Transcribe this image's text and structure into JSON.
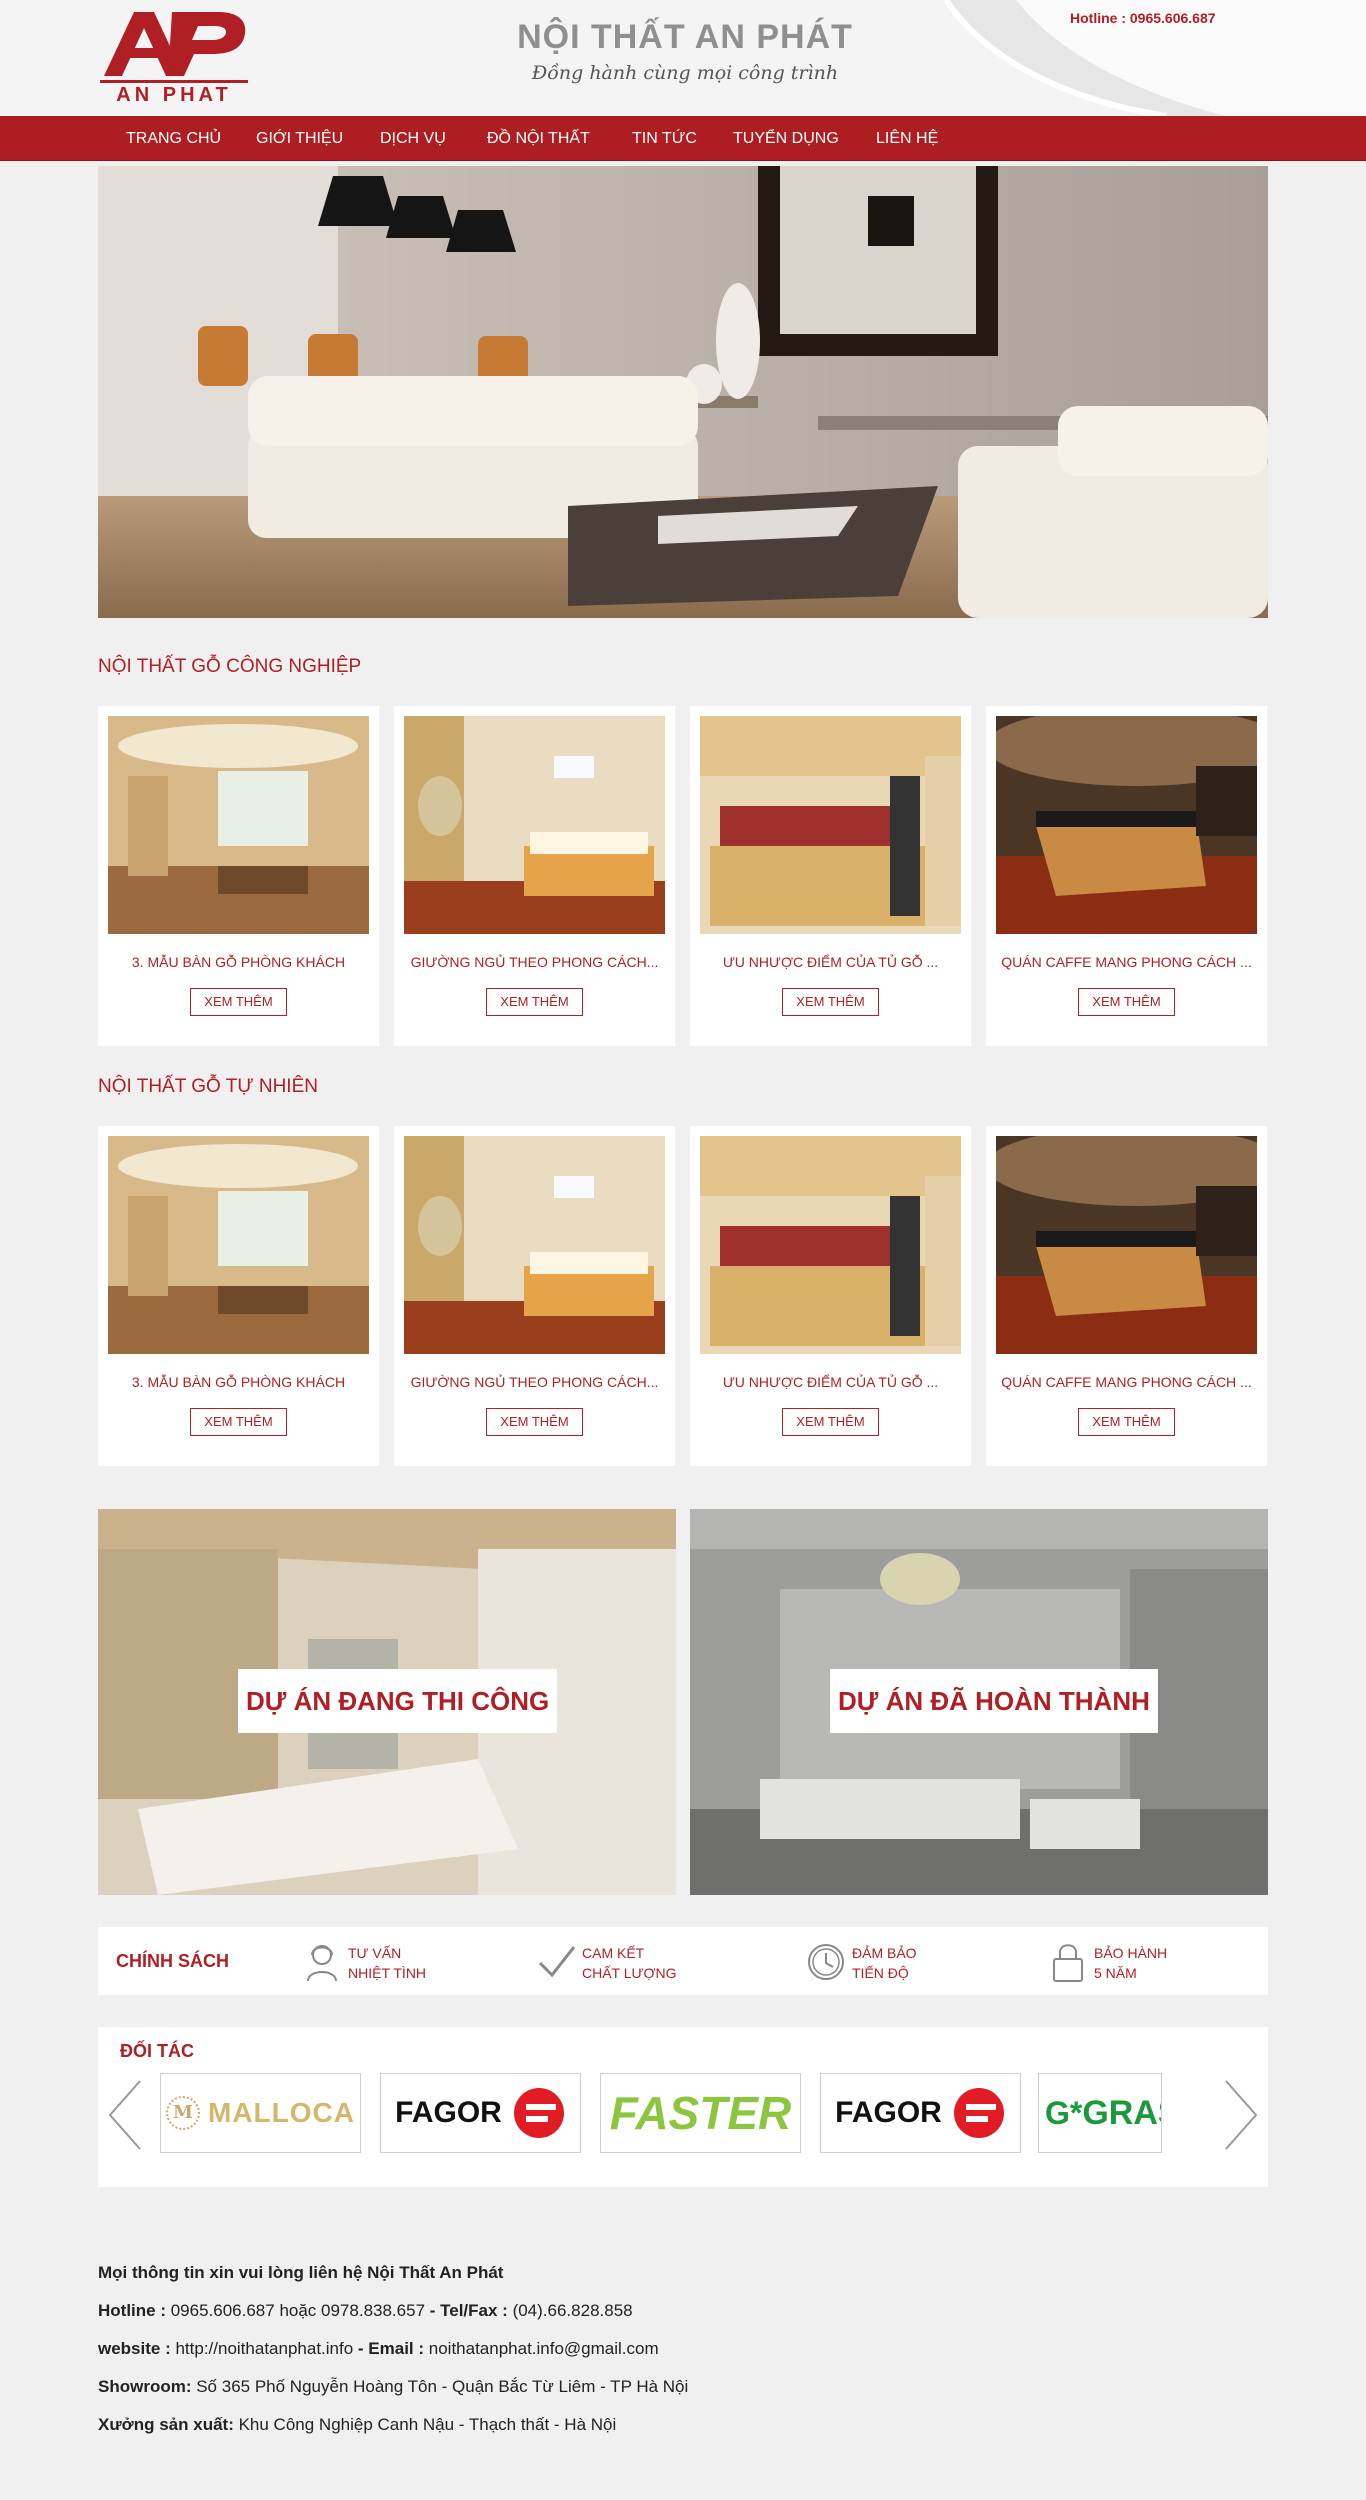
{
  "header": {
    "logo_mark": "AP",
    "logo_text": "AN PHAT",
    "brand_title": "NỘI THẤT AN PHÁT",
    "slogan": "Đồng hành cùng mọi công trình",
    "hotline": "Hotline : 0965.606.687",
    "brand_color": "#ad1d21"
  },
  "nav": {
    "items": [
      "TRANG CHỦ",
      "GIỚI THIỆU",
      "DỊCH VỤ",
      "ĐỒ NỘI THẤT",
      "TIN TỨC",
      "TUYỂN DỤNG",
      "LIÊN HỆ"
    ]
  },
  "sections": [
    {
      "title": "NỘI THẤT GỖ CÔNG NGHIỆP",
      "cards": [
        {
          "title": "3. MẪU BÀN GỖ PHÒNG KHÁCH",
          "button": "XEM THÊM",
          "image": "living-room"
        },
        {
          "title": "GIƯỜNG NGỦ THEO PHONG CÁCH...",
          "button": "XEM THÊM",
          "image": "bedroom"
        },
        {
          "title": "ƯU NHƯỢC ĐIỂM CỦA TỦ GỖ ...",
          "button": "XEM THÊM",
          "image": "kitchen"
        },
        {
          "title": "QUÁN CAFFE MANG PHONG CÁCH ...",
          "button": "XEM THÊM",
          "image": "cafe"
        }
      ]
    },
    {
      "title": "NỘI THẤT GỖ TỰ NHIÊN",
      "cards": [
        {
          "title": "3. MẪU BÀN GỖ PHÒNG KHÁCH",
          "button": "XEM THÊM",
          "image": "living-room"
        },
        {
          "title": "GIƯỜNG NGỦ THEO PHONG CÁCH...",
          "button": "XEM THÊM",
          "image": "bedroom"
        },
        {
          "title": "ƯU NHƯỢC ĐIỂM CỦA TỦ GỖ ...",
          "button": "XEM THÊM",
          "image": "kitchen"
        },
        {
          "title": "QUÁN CAFFE MANG PHONG CÁCH ...",
          "button": "XEM THÊM",
          "image": "cafe"
        }
      ]
    }
  ],
  "projects": {
    "ongoing": "DỰ ÁN ĐANG THI CÔNG",
    "completed": "DỰ ÁN ĐÃ HOÀN THÀNH"
  },
  "policy": {
    "title": "CHÍNH SÁCH",
    "items": [
      {
        "line1": "TƯ VẤN",
        "line2": "NHIỆT TÌNH",
        "icon": "consultant-icon"
      },
      {
        "line1": "CAM KẾT",
        "line2": "CHẤT LƯỢNG",
        "icon": "checkmark-icon"
      },
      {
        "line1": "ĐẢM BẢO",
        "line2": "TIẾN ĐỘ",
        "icon": "clock-icon"
      },
      {
        "line1": "BẢO HÀNH",
        "line2": "5 NĂM",
        "icon": "lock-icon"
      }
    ]
  },
  "partners": {
    "title": "ĐỐI TÁC",
    "logos": [
      "MALLOCA",
      "FAGOR",
      "FASTER",
      "FAGOR",
      "GRASS"
    ],
    "malloca_mark": "M",
    "grass_prefix": "G*"
  },
  "footer": {
    "intro": "Mọi thông tin xin vui lòng liên hệ Nội Thất An Phát",
    "hotline_label": "Hotline  :",
    "hotline_value": " 0965.606.687 hoặc 0978.838.657 ",
    "fax_label": " - Tel/Fax :",
    "fax_value": " (04).66.828.858",
    "website_label": "website :",
    "website_value": " http://noithatanphat.info ",
    "email_label": "- Email :",
    "email_value": " noithatanphat.info@gmail.com",
    "showroom_label": "Showroom:",
    "showroom_value": " Số 365 Phố Nguyễn Hoàng Tôn -  Quận Bắc Từ Liêm - TP Hà Nội",
    "factory_label": "Xưởng sản xuất:",
    "factory_value": " Khu Công Nghiệp Canh Nậu - Thạch thất - Hà Nội"
  }
}
